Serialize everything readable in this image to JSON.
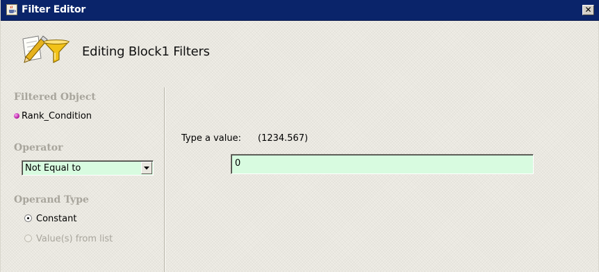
{
  "window": {
    "title": "Filter Editor",
    "close_label": "✕"
  },
  "header": {
    "title": "Editing Block1 Filters"
  },
  "left_panel": {
    "filtered_object_label": "Filtered Object",
    "filtered_object_value": "Rank_Condition",
    "operator_label": "Operator",
    "operator_value": "Not Equal to",
    "operand_type_label": "Operand Type",
    "operand_options": [
      {
        "label": "Constant",
        "selected": true,
        "enabled": true
      },
      {
        "label": "Value(s) from list",
        "selected": false,
        "enabled": false
      }
    ]
  },
  "right_panel": {
    "type_value_label": "Type a value:",
    "type_value_example": "(1234.567)",
    "value_input": "0"
  },
  "colors": {
    "titlebar": "#0a246a",
    "input_background": "#d8fbe0",
    "disabled_text": "#a8a59c",
    "object_dot": "#b0129c"
  },
  "icons": {
    "title": "java-cup-icon",
    "header": "pencil-funnel-icon",
    "object": "object-dot-icon",
    "close": "close-icon",
    "dropdown": "chevron-down-icon"
  }
}
